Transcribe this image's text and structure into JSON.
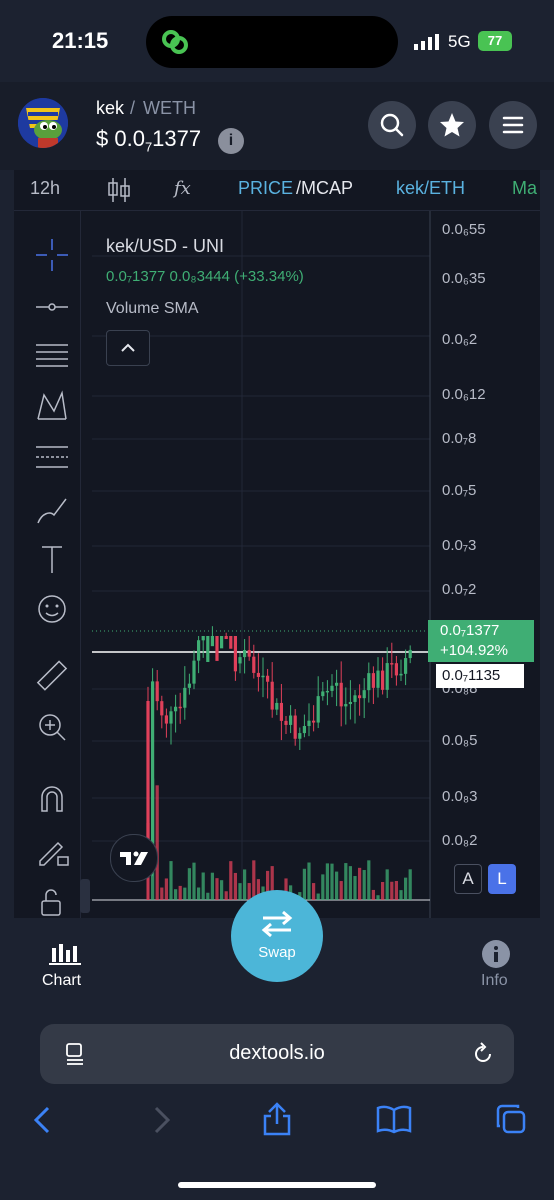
{
  "status_bar": {
    "time": "21:15",
    "network": "5G",
    "battery": "77"
  },
  "header": {
    "base_token": "kek",
    "separator": "/",
    "quote_token": "WETH",
    "price_prefix": "$ 0.0",
    "price_sub": "7",
    "price_suffix": "1377",
    "info_label": "i"
  },
  "toolbar": {
    "interval": "12h",
    "fx_label": "fx",
    "price_label": "PRICE",
    "mcap_label": "/MCAP",
    "pair_toggle": "kek/ETH",
    "more_label": "Ma"
  },
  "chart": {
    "legend_title": "kek/USD - UNI",
    "legend_values": "0.0₇1377  0.0₈3444 (+33.34%)",
    "legend_volume": "Volume SMA",
    "y_ticks": [
      "0.0₆55",
      "0.0₆35",
      "0.0₆2",
      "0.0₆12",
      "0.0₇8",
      "0.0₇5",
      "0.0₇3",
      "0.0₇2",
      "0.0₈8",
      "0.0₈5",
      "0.0₈3",
      "0.0₈2"
    ],
    "last_price": "0.0₇1377",
    "last_change": "+104.92%",
    "ref_price": "0.0₇1135",
    "scale_auto": "A",
    "scale_log": "L",
    "colors": {
      "up": "#3fae74",
      "down": "#e0405a",
      "accent": "#5ab2e0"
    }
  },
  "chart_data": {
    "type": "candlestick",
    "title": "kek/USD - UNI",
    "last_close": "0.0₇1377",
    "change": "0.0₈3444 (+33.34%)",
    "change_since_ref": "+104.92%",
    "y_scale": "log"
  },
  "tabs": {
    "chart_label": "Chart",
    "swap_label": "Swap",
    "info_label": "Info"
  },
  "browser": {
    "url": "dextools.io"
  }
}
